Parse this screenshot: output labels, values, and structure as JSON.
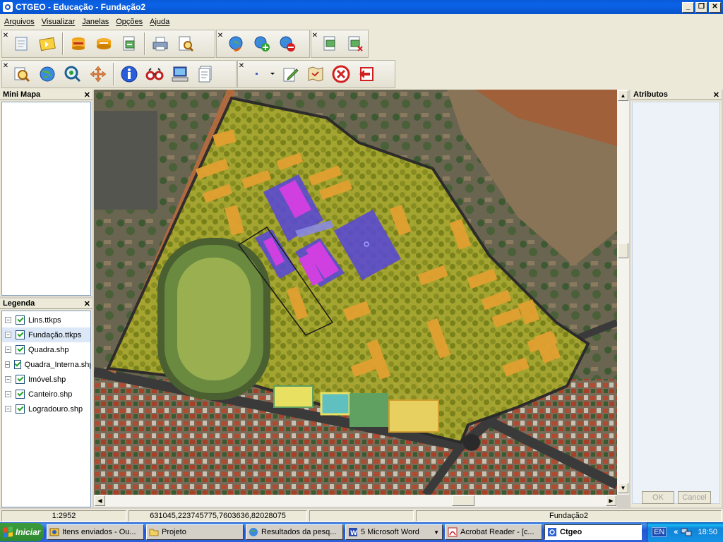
{
  "window": {
    "title": "CTGEO - Educação - Fundação2",
    "minimize": "_",
    "maximize": "❐",
    "close": "✕"
  },
  "menu": [
    "Arquivos",
    "Visualizar",
    "Janelas",
    "Opções",
    "Ajuda"
  ],
  "toolbar1": {
    "group1": [
      "open-folder-icon",
      "open-project-icon"
    ],
    "group2": [
      "database-icon",
      "database-connect-icon",
      "export-icon"
    ],
    "group3": [
      "print-icon",
      "print-preview-icon"
    ],
    "group4": [
      "globe-refresh-icon",
      "globe-add-icon",
      "globe-remove-icon"
    ],
    "group5": [
      "layer-add-icon",
      "layer-remove-icon"
    ]
  },
  "toolbar2": {
    "group1": [
      "zoom-icon",
      "globe-icon",
      "zoom-area-icon",
      "pan-icon"
    ],
    "group2": [
      "info-icon",
      "binoculars-icon",
      "computer-icon",
      "document-icon"
    ],
    "group3": [
      "point-icon",
      "edit-pencil-icon",
      "map-edit-icon",
      "stop-icon",
      "exit-icon"
    ]
  },
  "panels": {
    "mini_mapa": {
      "title": "Mini Mapa",
      "close": "✕"
    },
    "legenda": {
      "title": "Legenda",
      "close": "✕",
      "layers": [
        {
          "name": "Lins.ttkps",
          "checked": true,
          "selected": false
        },
        {
          "name": "Fundação.ttkps",
          "checked": true,
          "selected": true
        },
        {
          "name": "Quadra.shp",
          "checked": true,
          "selected": false
        },
        {
          "name": "Quadra_Interna.shp",
          "checked": true,
          "selected": false
        },
        {
          "name": "Imóvel.shp",
          "checked": true,
          "selected": false
        },
        {
          "name": "Canteiro.shp",
          "checked": true,
          "selected": false
        },
        {
          "name": "Logradouro.shp",
          "checked": true,
          "selected": false
        }
      ]
    },
    "atributos": {
      "title": "Atributos",
      "close": "✕",
      "ok": "OK",
      "cancel": "Cancel"
    }
  },
  "map": {
    "scrollbar_up": "▲",
    "scrollbar_down": "▼",
    "scrollbar_left": "◀",
    "scrollbar_right": "▶",
    "colors": {
      "area": "#c8c832",
      "building": "#e2a030",
      "block": "#5a4ad0",
      "highlight": "#d040e0"
    }
  },
  "status": {
    "scale": "1:2952",
    "coords": "631045,223745775,7603636,82028075",
    "empty": "",
    "layer": "Fundação2"
  },
  "taskbar": {
    "start": "Iniciar",
    "tasks": [
      {
        "label": "Itens enviados - Ou...",
        "active": false
      },
      {
        "label": "Projeto",
        "active": false
      },
      {
        "label": "Resultados da pesq...",
        "active": false
      },
      {
        "label": "5 Microsoft Word",
        "active": false
      },
      {
        "label": "Acrobat Reader - [c...",
        "active": false
      },
      {
        "label": "Ctgeo",
        "active": true
      }
    ],
    "lang": "EN",
    "tray_arrow": "«",
    "time": "18:50"
  }
}
